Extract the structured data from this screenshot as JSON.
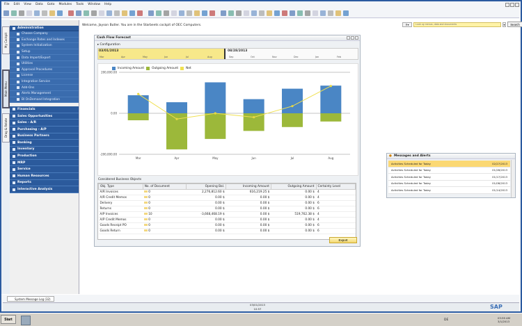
{
  "menu": [
    "File",
    "Edit",
    "View",
    "Data",
    "Goto",
    "Modules",
    "Tools",
    "Window",
    "Help"
  ],
  "welcome": "Welcome, Jayson Butler. You are in the Starbeets cockpit of OEC Computers.",
  "search": {
    "placeholder": "Look up menus, data and documents",
    "button": "Search"
  },
  "vtabs": [
    "My Cockpit",
    "Main Menu",
    "Drag & Relate"
  ],
  "sidebar": {
    "header": "Administration",
    "subitems": [
      "Choose Company",
      "Exchange Rates and Indexes",
      "System Initialization",
      "Setup",
      "Data Import/Export",
      "Utilities",
      "Approval Procedures",
      "License",
      "Integration Service",
      "Add-Ons",
      "Alerts Management",
      "BI OnDemand Integration"
    ],
    "modules": [
      "Financials",
      "Sales Opportunities",
      "Sales - A/R",
      "Purchasing - A/P",
      "Business Partners",
      "Banking",
      "Inventory",
      "Production",
      "MRP",
      "Service",
      "Human Resources",
      "Reports",
      "Interactive Analysis"
    ]
  },
  "cashflow": {
    "title": "Cash Flow Forecast",
    "config": "Configuration",
    "timeline": {
      "start": "03/01/2013",
      "end": "08/28/2013",
      "months": [
        "Mar",
        "Apr",
        "May",
        "Jun",
        "Jul",
        "Aug",
        "Sep",
        "Oct",
        "Nov",
        "Dec",
        "Jan",
        "Feb"
      ]
    },
    "section": "Considered Business Objects",
    "export": "Export",
    "columns": [
      "Obj. Type",
      "No. of Document",
      "Opening Bal.",
      "Incoming Amount",
      "Outgoing Amount",
      "Certainty Level"
    ],
    "rows": [
      [
        "A/R Invoices",
        "0",
        "2,276,812.60 $",
        "616,219.25 $",
        "0.00 $",
        "4"
      ],
      [
        "A/R Credit Memos",
        "0",
        "0.00 $",
        "0.00 $",
        "0.00 $",
        "4"
      ],
      [
        "Delivery",
        "0",
        "0.00 $",
        "0.00 $",
        "0.00 $",
        "6"
      ],
      [
        "Returns",
        "0",
        "0.00 $",
        "0.00 $",
        "0.00 $",
        "6"
      ],
      [
        "A/P Invoices",
        "10",
        "-3,668,468.19 $",
        "0.00 $",
        "519,762.38 $",
        "4"
      ],
      [
        "A/P Credit Memos",
        "0",
        "0.00 $",
        "0.00 $",
        "0.00 $",
        "4"
      ],
      [
        "Goods Receipt PO",
        "0",
        "0.00 $",
        "0.00 $",
        "0.00 $",
        "6"
      ],
      [
        "Goods Return",
        "0",
        "0.00 $",
        "0.00 $",
        "0.00 $",
        "6"
      ]
    ]
  },
  "chart_data": {
    "type": "bar",
    "categories": [
      "Mar",
      "Apr",
      "May",
      "Jun",
      "Jul",
      "Aug"
    ],
    "series": [
      {
        "name": "Incoming Amount",
        "values": [
          88000,
          54000,
          151000,
          69000,
          120000,
          135000
        ],
        "color": "#4a86c5"
      },
      {
        "name": "Outgoing Amount",
        "values": [
          -34000,
          -176000,
          -125000,
          -86000,
          -67000,
          -40000
        ],
        "color": "#9cb83a"
      },
      {
        "name": "Net",
        "type": "line",
        "values": [
          94000,
          -28000,
          0,
          -19000,
          35000,
          133000
        ],
        "color": "#f0e050"
      }
    ],
    "yticks": [
      "200,000.00",
      "0.00",
      "-200,000.00"
    ],
    "ylim": [
      -200000,
      200000
    ],
    "legend": "top-left"
  },
  "messages": {
    "title": "Messages and Alerts",
    "items": [
      {
        "text": "Activities Scheduled for Today",
        "date": "02/27/2013"
      },
      {
        "text": "Activities Scheduled for Today",
        "date": "01/28/2013"
      },
      {
        "text": "Activities Scheduled for Today",
        "date": "01/17/2013"
      },
      {
        "text": "Activities Scheduled for Today",
        "date": "01/08/2013"
      },
      {
        "text": "Activities Scheduled for Today",
        "date": "01/14/2013"
      }
    ]
  },
  "log_tab": "System Message Log (32)",
  "status": {
    "date": "03/01/2013",
    "time": "10:57"
  },
  "taskbar": {
    "start": "Start",
    "lang": "DE",
    "time": "03:59 AM",
    "date": "3/1/2013"
  },
  "logo": "SAP Business One"
}
